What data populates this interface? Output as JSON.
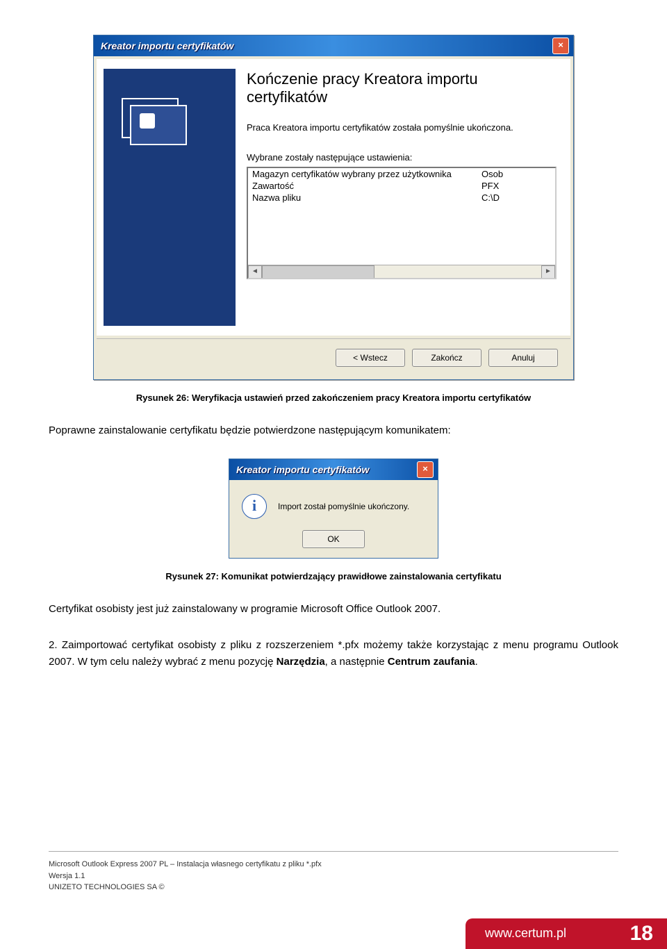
{
  "wizard": {
    "title": "Kreator importu certyfikatów",
    "heading": "Kończenie pracy Kreatora importu certyfikatów",
    "desc": "Praca Kreatora importu certyfikatów została pomyślnie ukończona.",
    "settings_label": "Wybrane zostały następujące ustawienia:",
    "rows": [
      {
        "label": "Magazyn certyfikatów wybrany przez użytkownika",
        "value": "Osob"
      },
      {
        "label": "Zawartość",
        "value": "PFX"
      },
      {
        "label": "Nazwa pliku",
        "value": "C:\\D"
      }
    ],
    "back_btn": "< Wstecz",
    "finish_btn": "Zakończ",
    "cancel_btn": "Anuluj"
  },
  "caption1": "Rysunek 26: Weryfikacja ustawień przed zakończeniem pracy Kreatora importu certyfikatów",
  "para1": "Poprawne zainstalowanie certyfikatu będzie potwierdzone następującym komunikatem:",
  "msgbox": {
    "title": "Kreator importu certyfikatów",
    "text": "Import został pomyślnie ukończony.",
    "ok_btn": "OK"
  },
  "caption2": "Rysunek 27: Komunikat potwierdzający prawidłowe zainstalowania certyfikatu",
  "para2": "Certyfikat osobisty jest już zainstalowany w programie Microsoft Office Outlook 2007.",
  "para3_pre": "2. Zaimportować certyfikat osobisty z pliku z rozszerzeniem *.pfx możemy także korzystając z menu programu Outlook 2007. W tym celu należy wybrać z menu pozycję ",
  "para3_bold1": "Narzędzia",
  "para3_mid": ", a następnie ",
  "para3_bold2": "Centrum zaufania",
  "para3_post": ".",
  "footer": {
    "line1": "Microsoft Outlook Express 2007 PL – Instalacja własnego certyfikatu z pliku *.pfx",
    "line2": "Wersja 1.1",
    "line3": "UNIZETO TECHNOLOGIES SA ©"
  },
  "certum_link": "www.certum.pl",
  "page_number": "18"
}
